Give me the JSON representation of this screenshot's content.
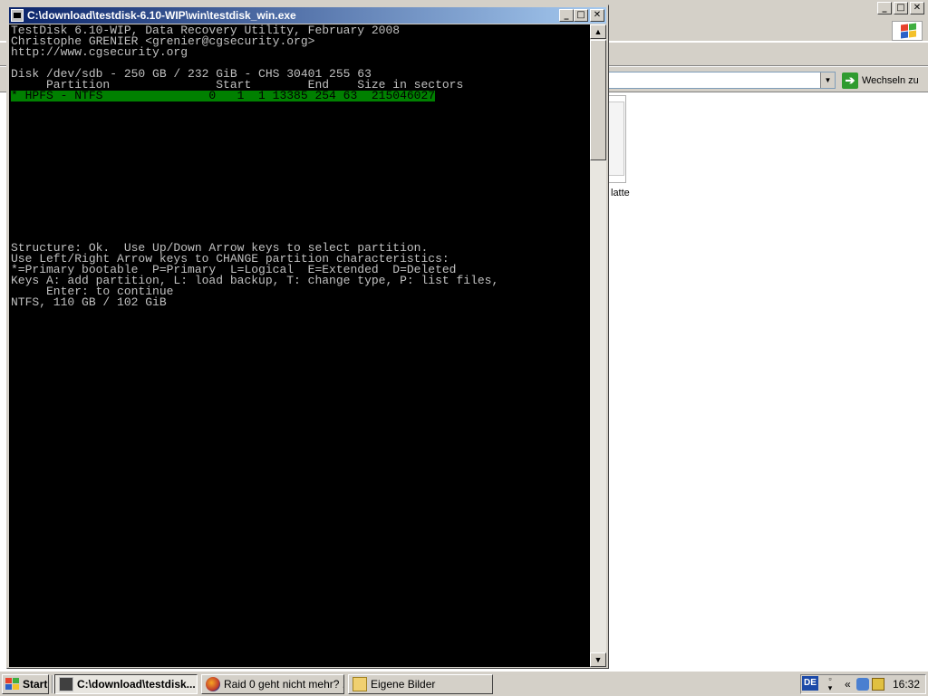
{
  "console": {
    "title": "C:\\download\\testdisk-6.10-WIP\\win\\testdisk_win.exe",
    "controls": {
      "minimize": "_",
      "maximize": "□",
      "close": "✕"
    },
    "lines": [
      "TestDisk 6.10-WIP, Data Recovery Utility, February 2008",
      "Christophe GRENIER <grenier@cgsecurity.org>",
      "http://www.cgsecurity.org",
      "",
      "Disk /dev/sdb - 250 GB / 232 GiB - CHS 30401 255 63",
      "     Partition               Start        End    Size in sectors",
      "* HPFS - NTFS               0   1  1 13385 254 63  215046027",
      "",
      "",
      "",
      "",
      "",
      "",
      "",
      "",
      "",
      "",
      "",
      "",
      "",
      "Structure: Ok.  Use Up/Down Arrow keys to select partition.",
      "Use Left/Right Arrow keys to CHANGE partition characteristics:",
      "*=Primary bootable  P=Primary  L=Logical  E=Extended  D=Deleted",
      "Keys A: add partition, L: load backup, T: change type, P: list files,",
      "     Enter: to continue",
      "NTFS, 110 GB / 102 GiB"
    ],
    "highlighted_line_index": 6,
    "scroll": {
      "up": "▲",
      "down": "▼"
    }
  },
  "background_window": {
    "go_label": "Wechseln zu",
    "go_icon": "arrow-right-icon",
    "thumbnail_label": "latte",
    "address_dropdown": "▼",
    "controls": {
      "minimize": "_",
      "maximize": "□",
      "close": "✕"
    }
  },
  "taskbar": {
    "start_label": "Start",
    "tasks": [
      {
        "label": "C:\\download\\testdisk...",
        "icon": "console-icon",
        "active": true
      },
      {
        "label": "Raid 0 geht nicht mehr? ...",
        "icon": "firefox-icon",
        "active": false
      },
      {
        "label": "Eigene Bilder",
        "icon": "folder-icon",
        "active": false
      }
    ],
    "language": "DE",
    "tray_chevron": "«",
    "clock": "16:32"
  },
  "colors": {
    "terminal_bg": "#000000",
    "terminal_fg": "#c0c0c0",
    "highlight": "#008000",
    "titlebar_start": "#0a246a",
    "titlebar_end": "#a6caf0"
  }
}
